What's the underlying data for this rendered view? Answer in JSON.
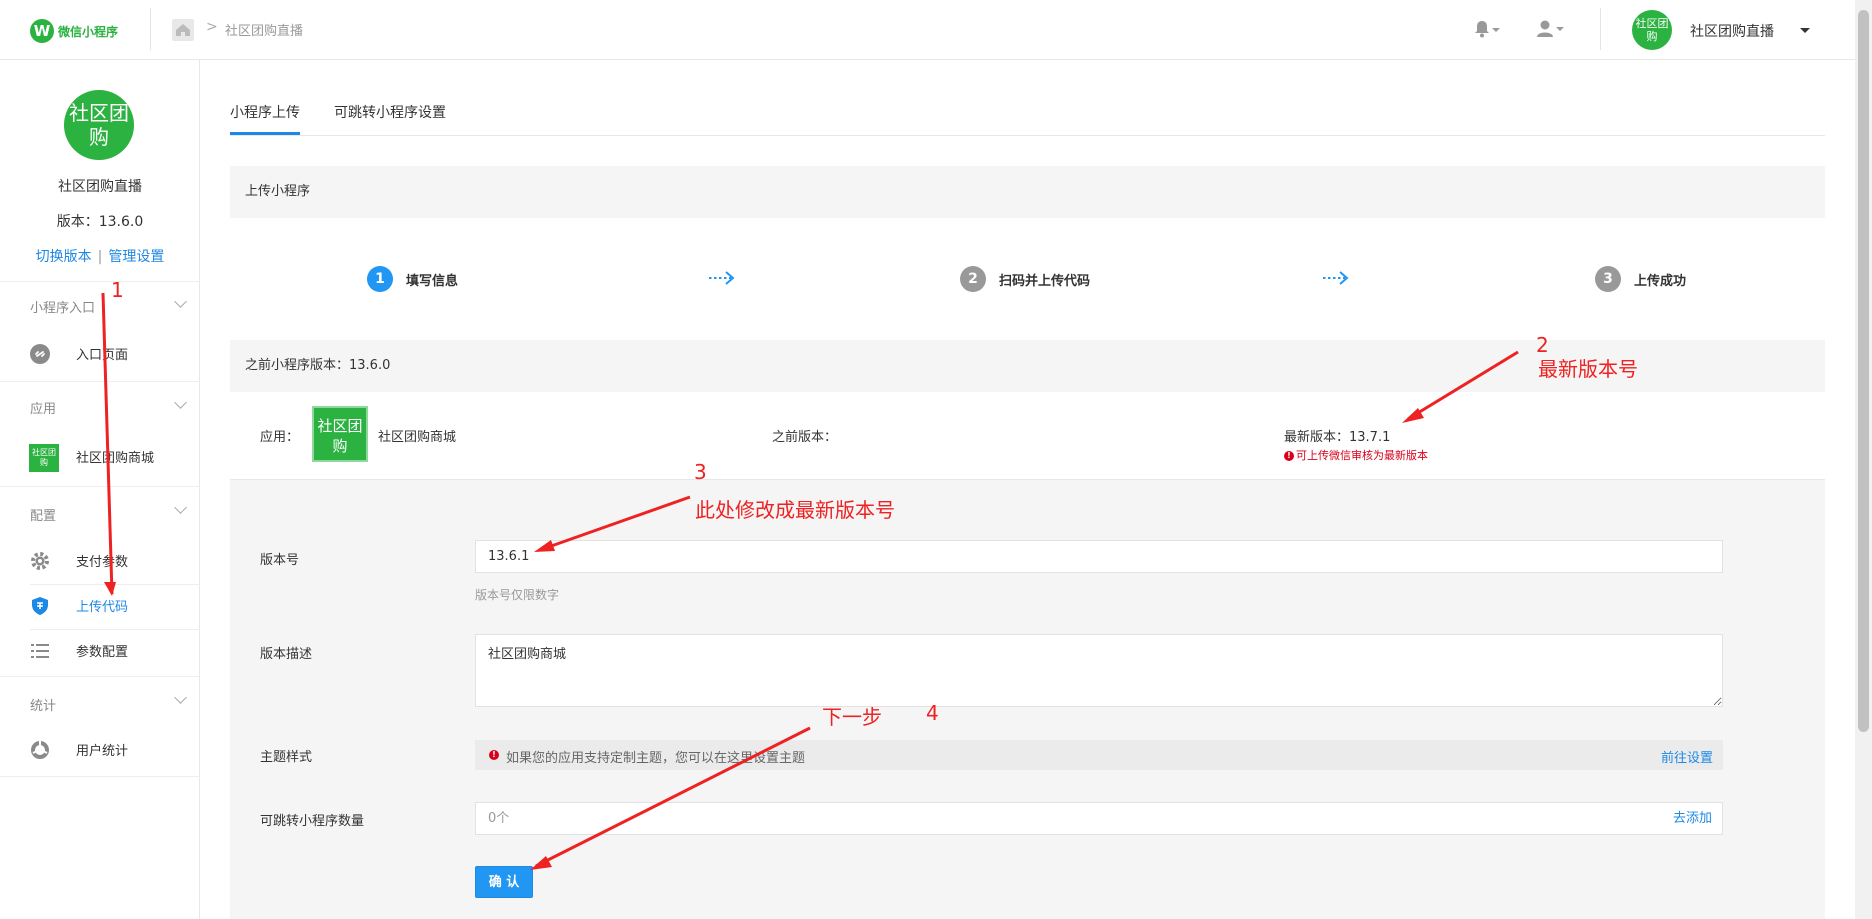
{
  "header": {
    "logo_text": "微信小程序",
    "breadcrumb": "社区团购直播",
    "user_name": "社区团购直播",
    "avatar_text": "社区团购"
  },
  "sidebar": {
    "logo_text": "社区团购",
    "app_name": "社区团购直播",
    "version": "版本：13.6.0",
    "switch_version": "切换版本",
    "manage_settings": "管理设置",
    "groups": [
      {
        "title": "小程序入口",
        "items": [
          {
            "label": "入口页面",
            "icon": "link-icon"
          }
        ]
      },
      {
        "title": "应用",
        "items": [
          {
            "label": "社区团购商城",
            "icon": "app-icon"
          }
        ]
      },
      {
        "title": "配置",
        "items": [
          {
            "label": "支付参数",
            "icon": "gear-icon"
          },
          {
            "label": "上传代码",
            "icon": "shield-icon"
          },
          {
            "label": "参数配置",
            "icon": "list-icon"
          }
        ]
      },
      {
        "title": "统计",
        "items": [
          {
            "label": "用户统计",
            "icon": "pie-icon"
          }
        ]
      }
    ],
    "app_icon_text": "社区团购"
  },
  "tabs": [
    {
      "label": "小程序上传"
    },
    {
      "label": "可跳转小程序设置"
    }
  ],
  "upload_title": "上传小程序",
  "steps": [
    {
      "num": "1",
      "label": "填写信息",
      "color": "#2196f3"
    },
    {
      "num": "2",
      "label": "扫码并上传代码",
      "color": "#999999"
    },
    {
      "num": "3",
      "label": "上传成功",
      "color": "#999999"
    }
  ],
  "previous_version_head": "之前小程序版本：13.6.0",
  "info": {
    "app_label": "应用：",
    "app_thumb": "社区团购",
    "app_name": "社区团购商城",
    "prev_version_label": "之前版本：",
    "latest_version_label": "最新版本：13.7.1",
    "latest_warning": "可上传微信审核为最新版本"
  },
  "form": {
    "version_label": "版本号",
    "version_value": "13.6.1",
    "version_hint": "版本号仅限数字",
    "desc_label": "版本描述",
    "desc_value": "社区团购商城",
    "theme_label": "主题样式",
    "theme_notice": "如果您的应用支持定制主题，您可以在这里设置主题",
    "theme_link": "前往设置",
    "jump_label": "可跳转小程序数量",
    "jump_value": "0个",
    "jump_link": "去添加",
    "confirm": "确 认"
  },
  "annotations": {
    "a1": "1",
    "a2": "2",
    "a2_text": "最新版本号",
    "a3": "3",
    "a3_text": "此处修改成最新版本号",
    "a4_text": "下一步",
    "a4": "4"
  },
  "colors": {
    "accent": "#1e88e5",
    "brand_green": "#2bb241",
    "annotation_red": "#ee2222",
    "warning_red": "#d9001b"
  }
}
